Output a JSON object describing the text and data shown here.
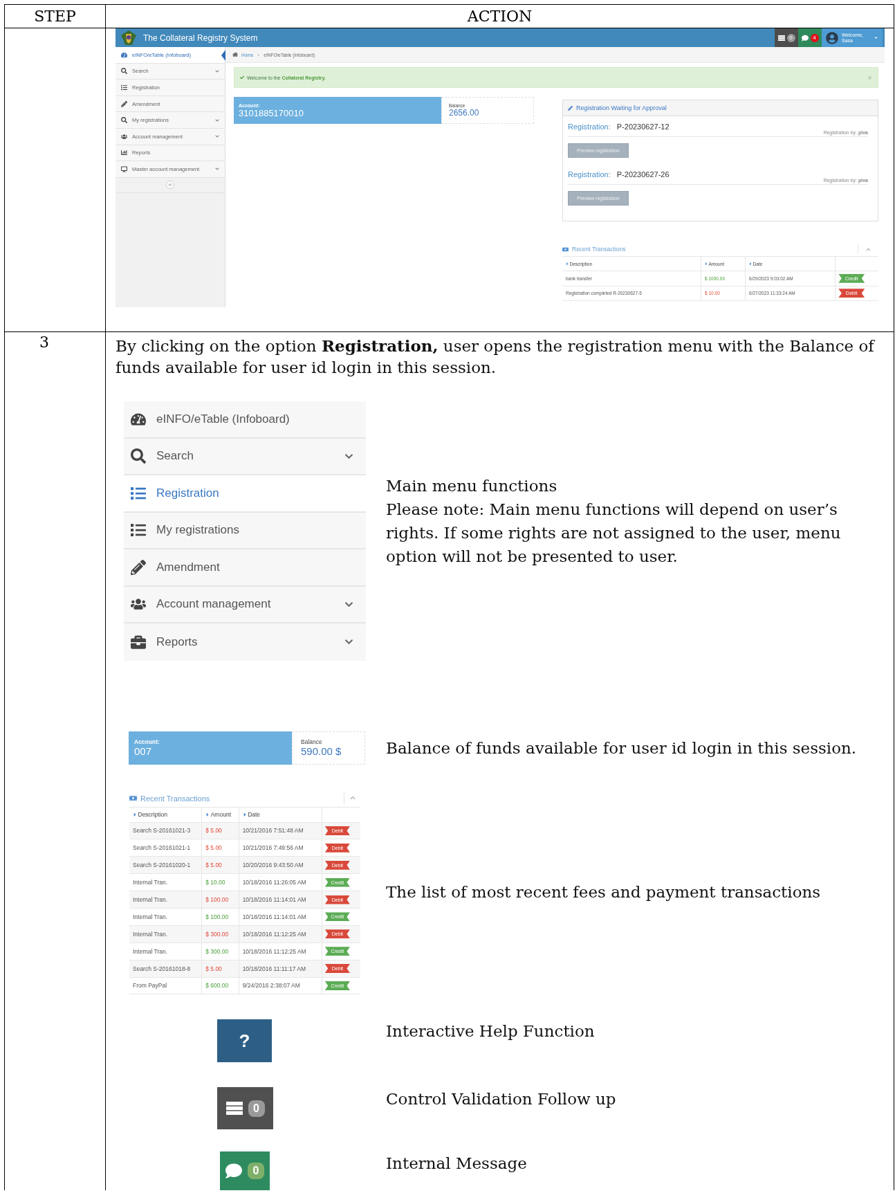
{
  "header": {
    "step": "STEP",
    "action": "ACTION"
  },
  "screenshot": {
    "app_title": "The Collateral Registry System",
    "header_badges": [
      {
        "kind": "tasks",
        "count": "0"
      },
      {
        "kind": "messages",
        "count": "4"
      }
    ],
    "user": {
      "greeting": "Welcome,",
      "name": "Sasa"
    },
    "sidebar": [
      {
        "label": "eINFO/eTable (Infoboard)",
        "selected": true,
        "expandable": false
      },
      {
        "label": "Search",
        "selected": false,
        "expandable": true
      },
      {
        "label": "Registration",
        "selected": false,
        "expandable": false
      },
      {
        "label": "Amendment",
        "selected": false,
        "expandable": false
      },
      {
        "label": "My registrations",
        "selected": false,
        "expandable": true
      },
      {
        "label": "Account management",
        "selected": false,
        "expandable": true
      },
      {
        "label": "Reports",
        "selected": false,
        "expandable": false
      },
      {
        "label": "Master account management",
        "selected": false,
        "expandable": true
      }
    ],
    "breadcrumb": [
      "Home",
      "eINFO/eTable (Infoboard)"
    ],
    "alert": {
      "text": "Welcome to the",
      "highlight": "Collateral Registry."
    },
    "account": {
      "label": "Account:",
      "number": "3101885170010"
    },
    "balance": {
      "label": "Balance",
      "value": "2656.00"
    },
    "approval": {
      "title": "Registration Waiting for Approval",
      "items": [
        {
          "label": "Registration:",
          "id": "P-20230627-12",
          "by_label": "Registration by:",
          "by": "piva",
          "button": "Preview registration"
        },
        {
          "label": "Registration:",
          "id": "P-20230627-26",
          "by_label": "Registration by:",
          "by": "piva",
          "button": "Preview registration"
        }
      ]
    },
    "transactions": {
      "title": "Recent Transactions",
      "columns": [
        "Description",
        "Amount",
        "Date"
      ],
      "rows": [
        {
          "description": "bank transfer",
          "amount": "$ 1000.00",
          "date": "6/29/2023 9:03:02 AM",
          "kind": "credit",
          "badge": "Credit"
        },
        {
          "description": "Registration completed R-20230627-5",
          "amount": "$ 10.00",
          "date": "6/27/2023 11:33:24 AM",
          "kind": "debit",
          "badge": "Debit"
        }
      ]
    }
  },
  "step": {
    "number": "3",
    "intro": "By clicking on the option **Registration,** user opens the registration menu with the Balance of funds available for user id login in this session.",
    "menu": [
      {
        "label": "eINFO/eTable (Infoboard)",
        "selected": false,
        "expandable": false
      },
      {
        "label": "Search",
        "selected": false,
        "expandable": true
      },
      {
        "label": "Registration",
        "selected": true,
        "expandable": false
      },
      {
        "label": "My registrations",
        "selected": false,
        "expandable": false
      },
      {
        "label": "Amendment",
        "selected": false,
        "expandable": false
      },
      {
        "label": "Account management",
        "selected": false,
        "expandable": true
      },
      {
        "label": "Reports",
        "selected": false,
        "expandable": true
      }
    ],
    "menu_note_title": "Main menu functions",
    "menu_note": "Please note: Main menu functions will depend on user’s rights. If some rights are not assigned to the user, menu option will not be presented to user.",
    "account": {
      "label": "Account:",
      "number": "007"
    },
    "balance": {
      "label": "Balance",
      "value": "590.00 $"
    },
    "balance_note": "Balance of funds available for user id login in this session.",
    "transactions": {
      "title": "Recent Transactions",
      "columns": [
        "Description",
        "Amount",
        "Date"
      ],
      "rows": [
        {
          "description": "Search S-20161021-3",
          "amount": "$ 5.00",
          "date": "10/21/2016 7:51:48 AM",
          "kind": "debit",
          "badge": "Debit"
        },
        {
          "description": "Search S-20161021-1",
          "amount": "$ 5.00",
          "date": "10/21/2016 7:49:56 AM",
          "kind": "debit",
          "badge": "Debit"
        },
        {
          "description": "Search S-20161020-1",
          "amount": "$ 5.00",
          "date": "10/20/2016 9:43:50 AM",
          "kind": "debit",
          "badge": "Debit"
        },
        {
          "description": "Internal Tran.",
          "amount": "$ 10.00",
          "date": "10/18/2016 11:26:05 AM",
          "kind": "credit",
          "badge": "Credit"
        },
        {
          "description": "Internal Tran.",
          "amount": "$ 100.00",
          "date": "10/18/2016 11:14:01 AM",
          "kind": "debit",
          "badge": "Debit"
        },
        {
          "description": "Internal Tran.",
          "amount": "$ 100.00",
          "date": "10/18/2016 11:14:01 AM",
          "kind": "credit",
          "badge": "Credit"
        },
        {
          "description": "Internal Tran.",
          "amount": "$ 300.00",
          "date": "10/18/2016 11:12:25 AM",
          "kind": "debit",
          "badge": "Debit"
        },
        {
          "description": "Internal Tran.",
          "amount": "$ 300.00",
          "date": "10/18/2016 11:12:25 AM",
          "kind": "credit",
          "badge": "Credit"
        },
        {
          "description": "Search S-20161018-8",
          "amount": "$ 5.00",
          "date": "10/18/2016 11:11:17 AM",
          "kind": "debit",
          "badge": "Debit"
        },
        {
          "description": "From PayPal",
          "amount": "$ 600.00",
          "date": "9/24/2016 2:38:07 AM",
          "kind": "credit",
          "badge": "Credit"
        }
      ]
    },
    "transactions_note": "The list of most recent fees and payment transactions",
    "buttons": [
      {
        "kind": "help",
        "label": "?",
        "note": "Interactive Help Function"
      },
      {
        "kind": "tasks",
        "count": "0",
        "note": "Control Validation Follow up"
      },
      {
        "kind": "messages",
        "count": "0",
        "note": "Internal Message"
      }
    ]
  }
}
